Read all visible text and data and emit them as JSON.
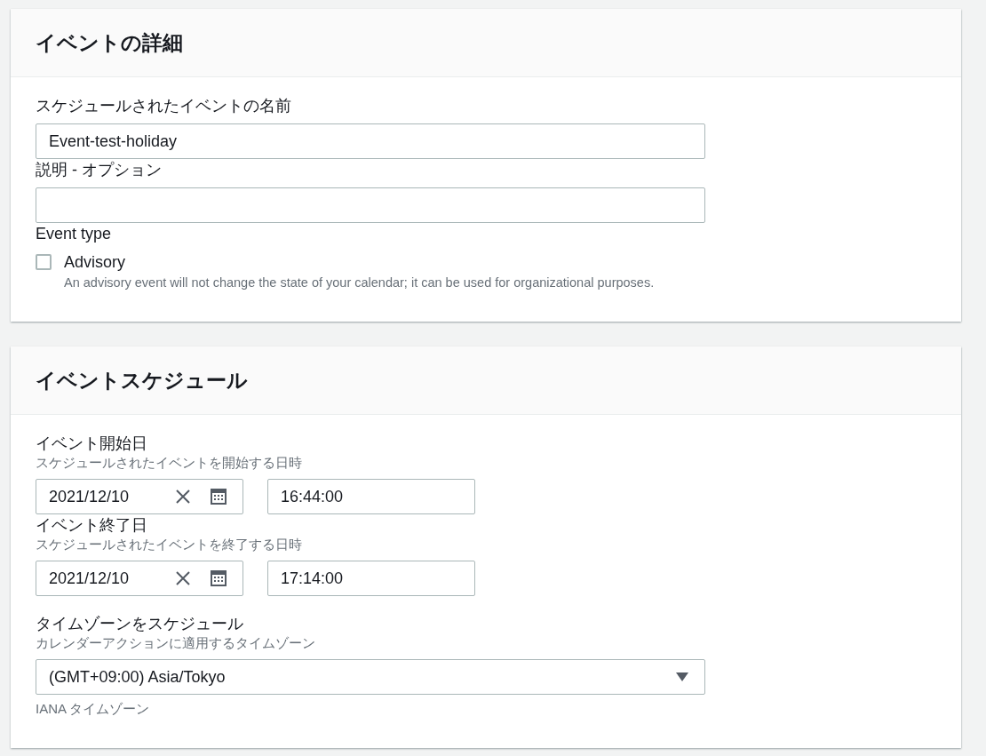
{
  "details": {
    "title": "イベントの詳細",
    "name_field": {
      "label": "スケジュールされたイベントの名前",
      "value": "Event-test-holiday"
    },
    "description_field": {
      "label": "説明 - オプション"
    },
    "event_type": {
      "label": "Event type",
      "checkbox": {
        "label": "Advisory",
        "checked": false,
        "description": "An advisory event will not change the state of your calendar; it can be used for organizational purposes."
      }
    }
  },
  "schedule": {
    "title": "イベントスケジュール",
    "start": {
      "label": "イベント開始日",
      "description": "スケジュールされたイベントを開始する日時",
      "date": "2021/12/10",
      "time": "16:44:00"
    },
    "end": {
      "label": "イベント終了日",
      "description": "スケジュールされたイベントを終了する日時",
      "date": "2021/12/10",
      "time": "17:14:00"
    },
    "timezone": {
      "label": "タイムゾーンをスケジュール",
      "description": "カレンダーアクションに適用するタイムゾーン",
      "value": "(GMT+09:00) Asia/Tokyo",
      "hint": "IANA タイムゾーン"
    }
  }
}
